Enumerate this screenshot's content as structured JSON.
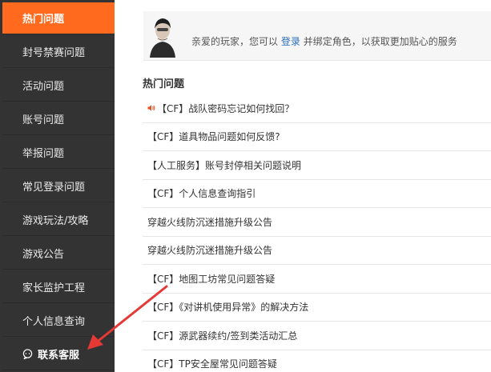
{
  "sidebar": {
    "items": [
      {
        "label": "热门问题",
        "active": true
      },
      {
        "label": "封号禁赛问题"
      },
      {
        "label": "活动问题"
      },
      {
        "label": "账号问题"
      },
      {
        "label": "举报问题"
      },
      {
        "label": "常见登录问题"
      },
      {
        "label": "游戏玩法/攻略"
      },
      {
        "label": "游戏公告"
      },
      {
        "label": "家长监护工程"
      },
      {
        "label": "个人信息查询"
      }
    ],
    "service": {
      "label": "联系客服",
      "icon": "chat-icon"
    }
  },
  "banner": {
    "prefix": "亲爱的玩家，您可以",
    "login_link": "登录",
    "suffix": "并绑定角色，以获取更加贴心的服务"
  },
  "section": {
    "title": "热门问题"
  },
  "questions": [
    {
      "text": "【CF】战队密码忘记如何找回？",
      "icon": "speaker-icon"
    },
    {
      "text": "【CF】道具物品问题如何反馈?"
    },
    {
      "text": "【人工服务】账号封停相关问题说明"
    },
    {
      "text": "【CF】个人信息查询指引"
    },
    {
      "text": "穿越火线防沉迷措施升级公告"
    },
    {
      "text": "穿越火线防沉迷措施升级公告"
    },
    {
      "text": "【CF】地图工坊常见问题答疑"
    },
    {
      "text": "【CF】《对讲机使用异常》的解决方法"
    },
    {
      "text": "【CF】源武器续约/签到类活动汇总"
    },
    {
      "text": "【CF】TP安全屋常见问题答疑"
    }
  ],
  "colors": {
    "accent": "#ff6a1e",
    "sidebar_bg": "#333333",
    "link": "#2a6ebb",
    "annotation_arrow": "#e53935"
  }
}
